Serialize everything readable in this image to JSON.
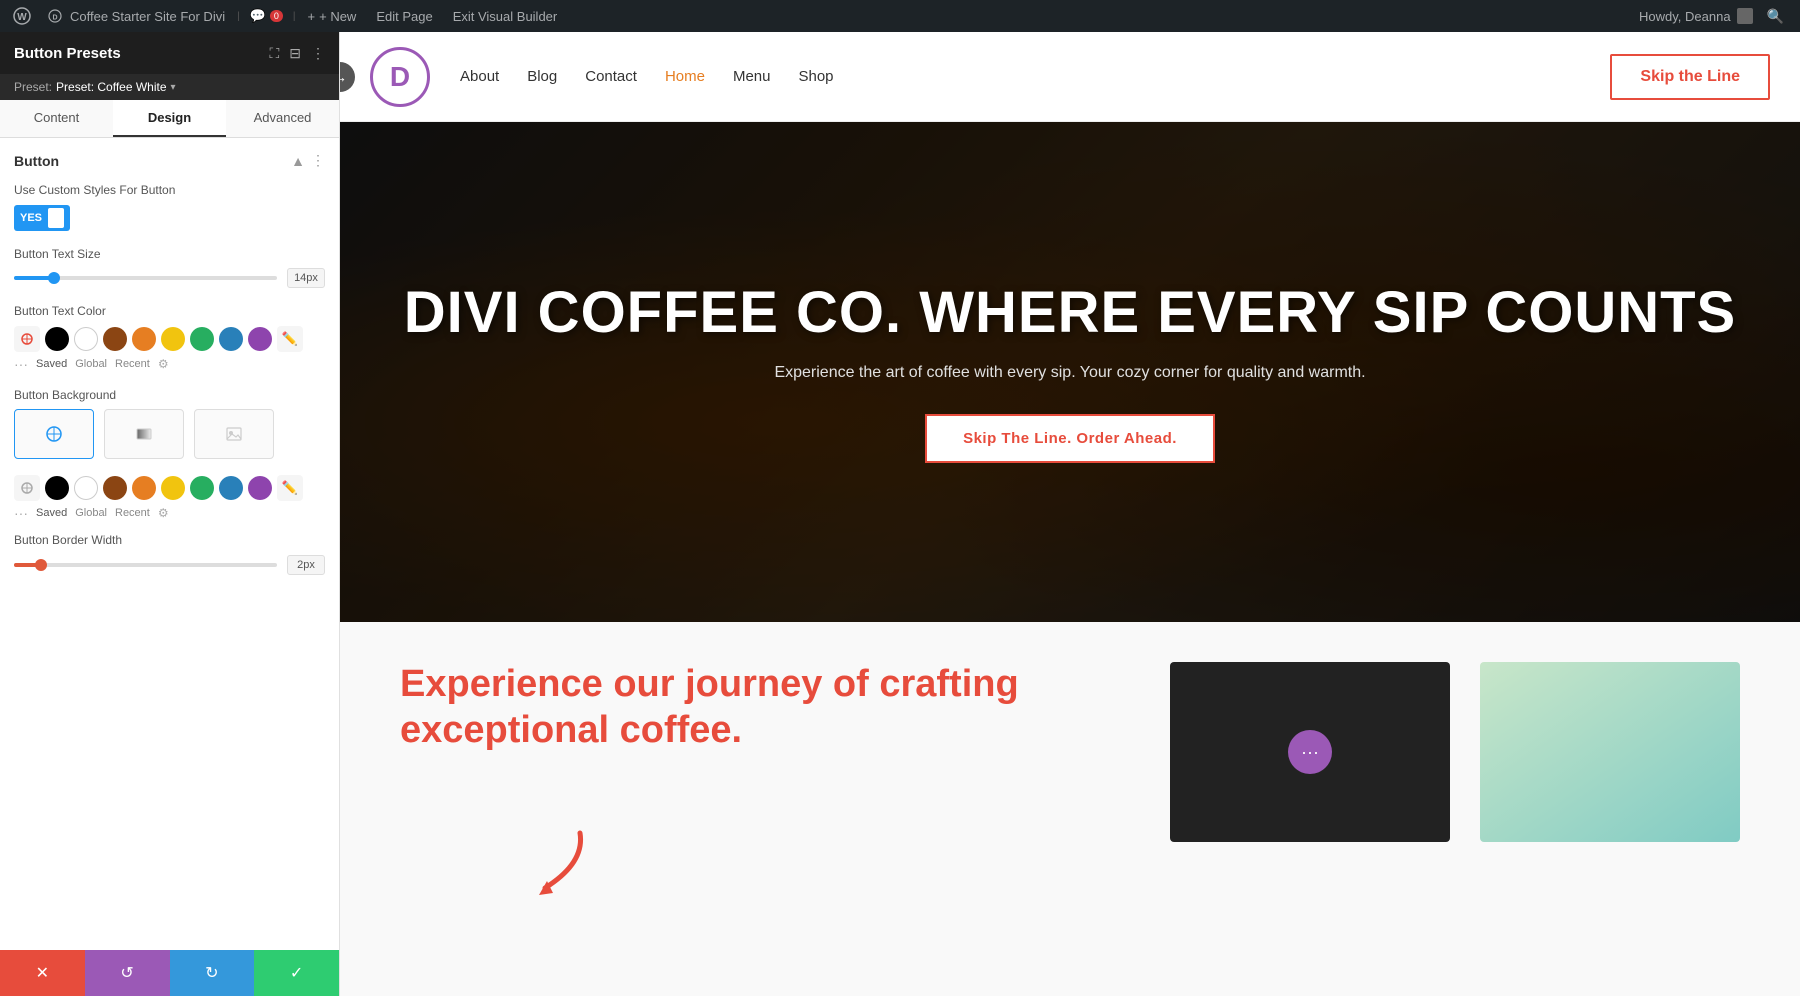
{
  "adminBar": {
    "wpLogo": "⊞",
    "siteName": "Coffee Starter Site For Divi",
    "commentIcon": "💬",
    "commentCount": "0",
    "newLabel": "+ New",
    "editPageLabel": "Edit Page",
    "exitBuilderLabel": "Exit Visual Builder",
    "howdyLabel": "Howdy, Deanna",
    "searchIcon": "🔍"
  },
  "sidebar": {
    "title": "Button Presets",
    "presetLabel": "Preset: Coffee White",
    "icons": {
      "fullscreen": "⛶",
      "panels": "⊟",
      "more": "⋮"
    },
    "tabs": {
      "content": "Content",
      "design": "Design",
      "advanced": "Advanced"
    },
    "activeTab": "Design",
    "section": {
      "title": "Button",
      "customStylesLabel": "Use Custom Styles For Button",
      "toggleYes": "YES",
      "buttonTextSizeLabel": "Button Text Size",
      "buttonTextSizeValue": "14px",
      "buttonTextColorLabel": "Button Text Color",
      "buttonBgLabel": "Button Background",
      "colorMeta": {
        "saved": "Saved",
        "global": "Global",
        "recent": "Recent"
      },
      "borderWidthLabel": "Button Border Width",
      "borderWidthValue": "2px"
    },
    "bottomActions": {
      "cancel": "✕",
      "reset": "↺",
      "redo": "↻",
      "save": "✓"
    }
  },
  "siteNav": {
    "logoLetter": "D",
    "links": [
      "About",
      "Blog",
      "Contact",
      "Home",
      "Menu",
      "Shop"
    ],
    "activeLink": "Home",
    "ctaButton": "Skip the Line"
  },
  "hero": {
    "title": "DIVI COFFEE CO. WHERE EVERY SIP COUNTS",
    "subtitle": "Experience the art of coffee with every sip. Your cozy corner for quality and warmth.",
    "ctaButton": "Skip The Line. Order Ahead."
  },
  "belowHero": {
    "title": "Experience our journey of crafting exceptional coffee."
  },
  "colors": {
    "orange": "#e74c3c",
    "black": "#000000",
    "white": "#ffffff",
    "brown": "#8B4513",
    "amber": "#e67e22",
    "yellow": "#f1c40f",
    "green": "#27ae60",
    "blue": "#2980b9",
    "purple": "#8e44ad",
    "redPen": "#e74c3c"
  },
  "sliderTextSize": {
    "fillPercent": 15,
    "thumbPercent": 15
  },
  "sliderBorder": {
    "fillPercent": 10,
    "thumbPercent": 8
  }
}
